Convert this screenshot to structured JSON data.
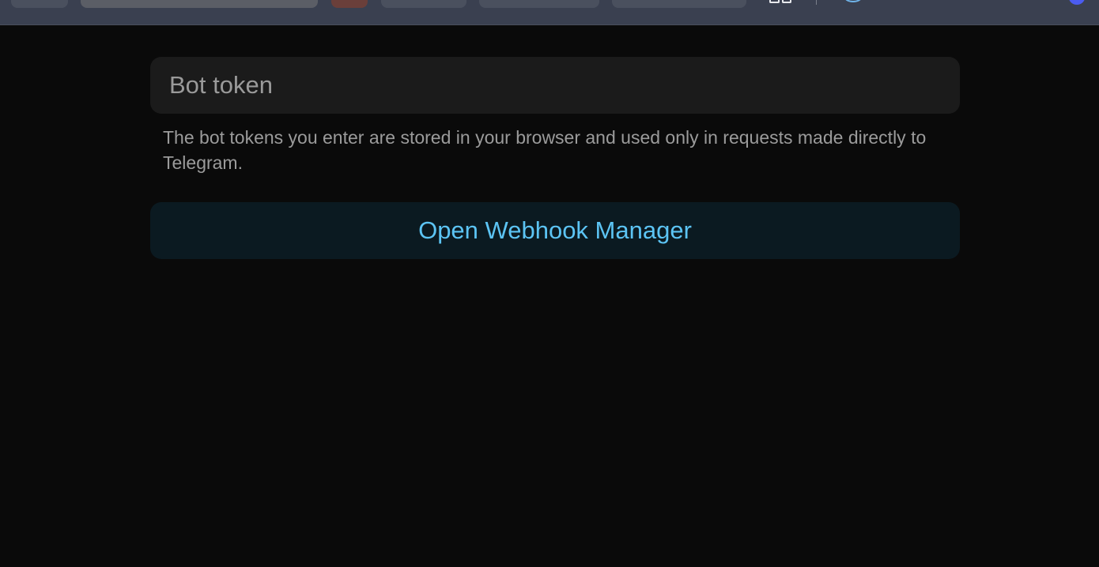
{
  "token_input": {
    "placeholder": "Bot token",
    "value": ""
  },
  "hint_text": "The bot tokens you enter are stored in your browser and used only in requests made directly to Telegram.",
  "open_button_label": "Open Webhook Manager",
  "colors": {
    "background": "#0a0a0a",
    "input_background": "#1b1b1b",
    "button_background": "#0b1a21",
    "button_text": "#5cc4f4",
    "hint_text": "#9b9b9b"
  },
  "browser_toolbar_icons": [
    "apps-grid-icon",
    "extension-loop-icon",
    "profile-avatar-icon"
  ]
}
